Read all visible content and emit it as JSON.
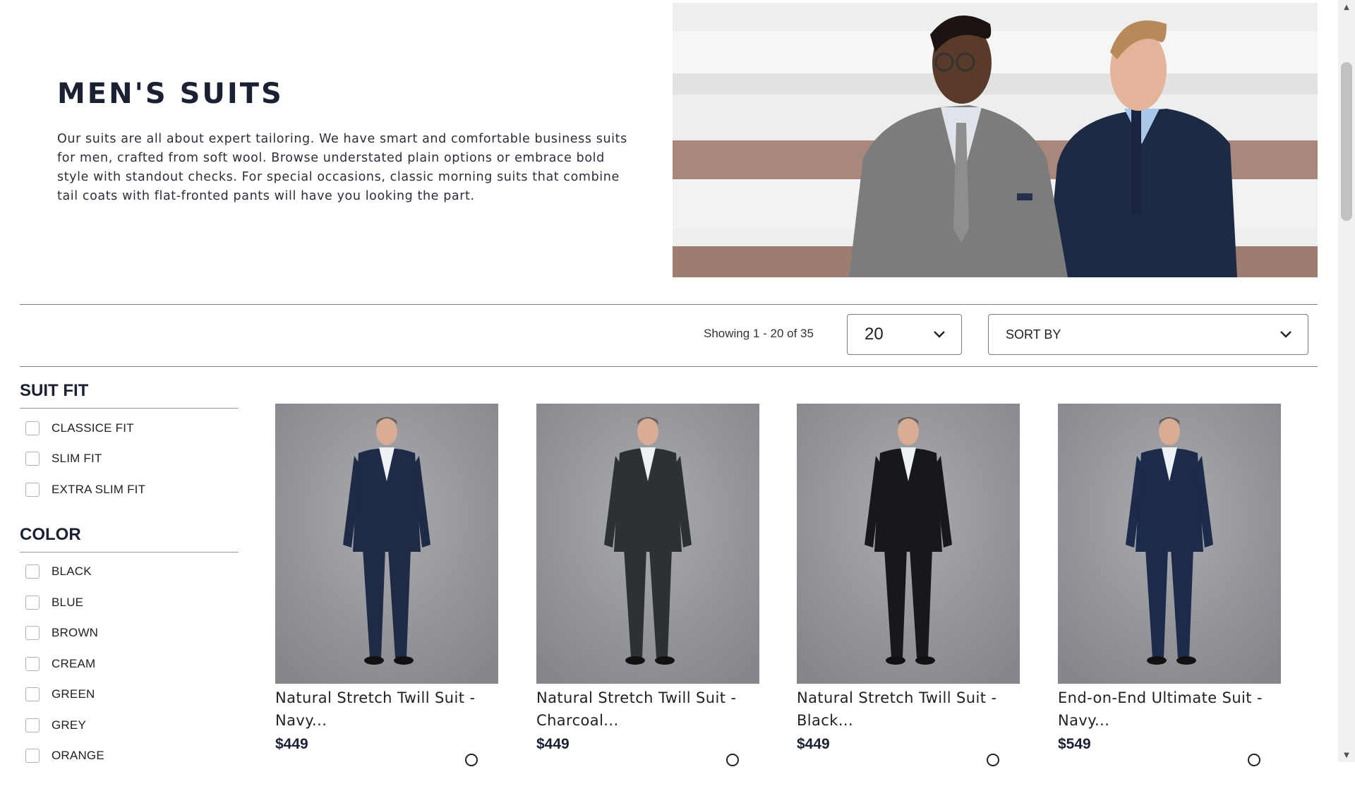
{
  "hero": {
    "title": "MEN'S SUITS",
    "intro": "Our suits are all about expert tailoring. We have smart and comfortable business suits for men, crafted from soft wool. Browse understated plain options or embrace bold style with standout checks. For special occasions, classic morning suits that combine tail coats with flat-fronted pants will have you looking the part."
  },
  "toolbar": {
    "showing": "Showing 1 - 20 of 35",
    "per_page_value": "20",
    "sort_label": "SORT BY"
  },
  "filters": [
    {
      "title": "SUIT FIT",
      "options": [
        "CLASSICE FIT",
        "SLIM FIT",
        "EXTRA SLIM FIT"
      ]
    },
    {
      "title": "COLOR",
      "options": [
        "BLACK",
        "BLUE",
        "BROWN",
        "CREAM",
        "GREEN",
        "GREY",
        "ORANGE"
      ]
    }
  ],
  "products": [
    {
      "name": "Natural Stretch Twill Suit - Navy...",
      "price": "$449",
      "color": "#1f2a44"
    },
    {
      "name": "Natural Stretch Twill Suit - Charcoal...",
      "price": "$449",
      "color": "#2e3133"
    },
    {
      "name": "Natural Stretch Twill Suit - Black...",
      "price": "$449",
      "color": "#16181c"
    },
    {
      "name": "End-on-End Ultimate Suit - Navy...",
      "price": "$549",
      "color": "#1d2b4a"
    }
  ]
}
